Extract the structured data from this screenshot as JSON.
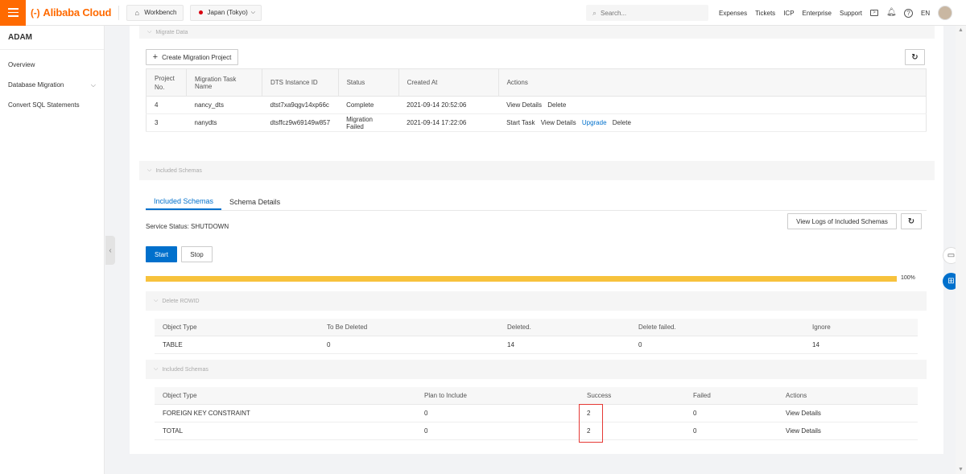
{
  "header": {
    "logo": "Alibaba Cloud",
    "workbench": "Workbench",
    "region": "Japan (Tokyo)",
    "search_placeholder": "Search...",
    "nav": [
      "Expenses",
      "Tickets",
      "ICP",
      "Enterprise",
      "Support"
    ],
    "lang": "EN"
  },
  "sidebar": {
    "title": "ADAM",
    "items": [
      {
        "label": "Overview"
      },
      {
        "label": "Database Migration"
      },
      {
        "label": "Convert SQL Statements"
      }
    ]
  },
  "migrate": {
    "section_title": "Migrate Data",
    "create_label": "Create Migration Project",
    "columns": [
      "Project No.",
      "Migration Task Name",
      "DTS Instance ID",
      "Status",
      "Created At",
      "Actions"
    ],
    "rows": [
      {
        "no": "4",
        "name": "nancy_dts",
        "dts": "dtst7xa9qgv14xp66c",
        "status": "Complete",
        "created": "2021-09-14 20:52:06",
        "actions": [
          "View Details",
          "Delete"
        ]
      },
      {
        "no": "3",
        "name": "nanydts",
        "dts": "dtsffcz9w69149w857",
        "status": "Migration Failed",
        "created": "2021-09-14 17:22:06",
        "actions": [
          "Start Task",
          "View Details",
          "Upgrade",
          "Delete"
        ]
      }
    ]
  },
  "schemas": {
    "section_title": "Included Schemas",
    "tabs": [
      "Included Schemas",
      "Schema Details"
    ],
    "service_status": "Service Status: SHUTDOWN",
    "view_logs": "View Logs of Included Schemas",
    "start": "Start",
    "stop": "Stop",
    "progress": 100,
    "progress_label": "100%",
    "delete_rowid": {
      "title": "Delete ROWID",
      "columns": [
        "Object Type",
        "To Be Deleted",
        "Deleted.",
        "Delete failed.",
        "Ignore"
      ],
      "rows": [
        [
          "TABLE",
          "0",
          "14",
          "0",
          "14"
        ]
      ]
    },
    "included": {
      "title": "Included Schemas",
      "columns": [
        "Object Type",
        "Plan to Include",
        "Success",
        "Failed",
        "Actions"
      ],
      "rows": [
        [
          "FOREIGN KEY CONSTRAINT",
          "0",
          "2",
          "0",
          "View Details"
        ],
        [
          "TOTAL",
          "0",
          "2",
          "0",
          "View Details"
        ]
      ]
    }
  },
  "colors": {
    "brand": "#ff6a00",
    "primary": "#0070cc",
    "progress": "#f7c23c",
    "highlight": "#e53935"
  }
}
